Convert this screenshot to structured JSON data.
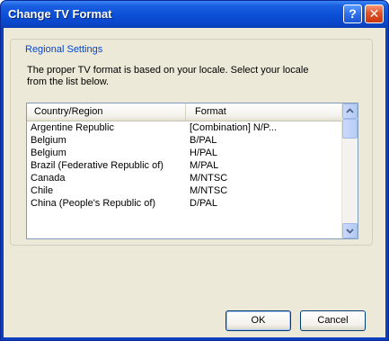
{
  "window": {
    "title": "Change TV Format",
    "help_glyph": "?",
    "close_glyph": "✕"
  },
  "group": {
    "label": "Regional Settings",
    "description": "The proper TV format is based on your locale. Select your locale from the list below."
  },
  "list": {
    "columns": [
      "Country/Region",
      "Format"
    ],
    "rows": [
      {
        "country": "Argentine Republic",
        "format": "[Combination] N/P..."
      },
      {
        "country": "Belgium",
        "format": "B/PAL"
      },
      {
        "country": "Belgium",
        "format": "H/PAL"
      },
      {
        "country": "Brazil (Federative Republic of)",
        "format": "M/PAL"
      },
      {
        "country": "Canada",
        "format": "M/NTSC"
      },
      {
        "country": "Chile",
        "format": "M/NTSC"
      },
      {
        "country": "China (People's Republic of)",
        "format": "D/PAL"
      }
    ]
  },
  "buttons": {
    "ok": "OK",
    "cancel": "Cancel"
  },
  "colors": {
    "title_bar": "#0a4fd6",
    "dialog_face": "#ece9d8",
    "group_label": "#0046d5",
    "close_button": "#e0512a"
  },
  "icons": {
    "help": "help-icon",
    "close": "close-icon",
    "scroll_up": "chevron-up-icon",
    "scroll_down": "chevron-down-icon"
  }
}
